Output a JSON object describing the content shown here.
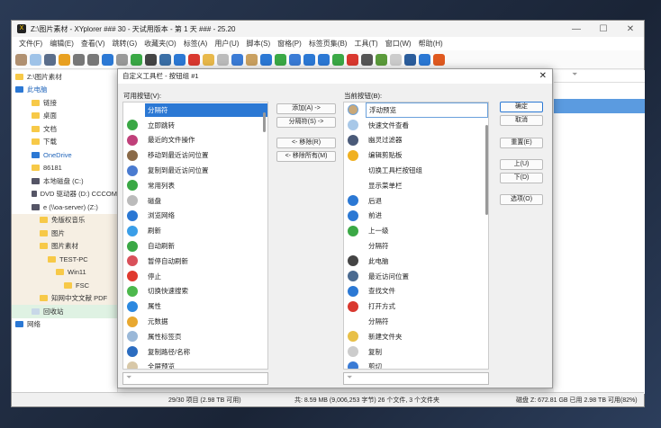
{
  "window": {
    "title": "Z:\\图片素材 - XYplorer ### 30 - 天试用版本 - 第 1 天 ### - 25.20",
    "controls": [
      "—",
      "☐",
      "✕"
    ]
  },
  "menu": [
    "文件(F)",
    "编辑(E)",
    "查看(V)",
    "跳转(G)",
    "收藏夹(O)",
    "标签(A)",
    "用户(U)",
    "脚本(S)",
    "窗格(P)",
    "标签页集(B)",
    "工具(T)",
    "窗口(W)",
    "帮助(H)"
  ],
  "toolbar_colors": [
    "#b09070",
    "#9fc3e8",
    "#5a6d8a",
    "#e8a020",
    "#777",
    "#777",
    "#2b78d4",
    "#999",
    "#3aa845",
    "#444",
    "#3a6ea5",
    "#2b78d4",
    "#d9382f",
    "#e8b84a",
    "#bbb",
    "#3a7bd5",
    "#c9a060",
    "#2b78d4",
    "#3aa845",
    "#3a7bd5",
    "#2b78d4",
    "#2b78d4",
    "#3aa845",
    "#d9382f",
    "#555",
    "#5a9a3a",
    "#ccc",
    "#2b5d9c",
    "#2b78d4",
    "#e05a20"
  ],
  "tree": [
    {
      "label": "Z:\\图片素材",
      "indent": 0,
      "type": "folder"
    },
    {
      "label": "此电脑",
      "indent": 0,
      "type": "pc",
      "blue": true
    },
    {
      "label": "链接",
      "indent": 2,
      "type": "folder"
    },
    {
      "label": "桌面",
      "indent": 2,
      "type": "folder"
    },
    {
      "label": "文档",
      "indent": 2,
      "type": "folder"
    },
    {
      "label": "下载",
      "indent": 2,
      "type": "folder"
    },
    {
      "label": "OneDrive",
      "indent": 2,
      "type": "cloud",
      "blue": true
    },
    {
      "label": "86181",
      "indent": 2,
      "type": "folder"
    },
    {
      "label": "本地磁盘 (C:)",
      "indent": 2,
      "type": "drive"
    },
    {
      "label": "DVD 驱动器 (D:) CCCOM",
      "indent": 2,
      "type": "drive"
    },
    {
      "label": "e (\\\\oa-server) (Z:)",
      "indent": 2,
      "type": "drive"
    },
    {
      "label": "免版权音乐",
      "indent": 3,
      "type": "folder",
      "sel": true
    },
    {
      "label": "图片",
      "indent": 3,
      "type": "folder",
      "sel": true
    },
    {
      "label": "图片素材",
      "indent": 3,
      "type": "folder",
      "sel": true
    },
    {
      "label": "TEST-PC",
      "indent": 4,
      "type": "folder",
      "sel": true
    },
    {
      "label": "Win11",
      "indent": 5,
      "type": "folder",
      "sel": true
    },
    {
      "label": "FSC",
      "indent": 6,
      "type": "folder",
      "sel": true
    },
    {
      "label": "知网中文文献 PDF",
      "indent": 3,
      "type": "folder",
      "sel": true
    },
    {
      "label": "回收站",
      "indent": 2,
      "type": "bin",
      "green": true
    },
    {
      "label": "网络",
      "indent": 0,
      "type": "net"
    }
  ],
  "dialog": {
    "title": "自定义工具栏 - 按钮组 #1",
    "close": "✕",
    "available_label": "可用按钮(V):",
    "current_label": "当前按钮(B):",
    "available": [
      {
        "label": "分隔符",
        "color": "",
        "selected": true
      },
      {
        "label": "立即跳转",
        "color": "#3aa845"
      },
      {
        "label": "最近的文件操作",
        "color": "#c0407a"
      },
      {
        "label": "移动到最近访问位置",
        "color": "#8a6a48"
      },
      {
        "label": "复制到最近访问位置",
        "color": "#4a7bd0"
      },
      {
        "label": "常用列表",
        "color": "#3aa845"
      },
      {
        "label": "磁盘",
        "color": "#bbbbbb"
      },
      {
        "label": "浏览网络",
        "color": "#2b78d4"
      },
      {
        "label": "刷新",
        "color": "#3a9ee8"
      },
      {
        "label": "自动刷新",
        "color": "#3aa845"
      },
      {
        "label": "暂停自动刷新",
        "color": "#d9505a"
      },
      {
        "label": "停止",
        "color": "#e03a2f"
      },
      {
        "label": "切换快速搜索",
        "color": "#4cb84c"
      },
      {
        "label": "属性",
        "color": "#2b88e0"
      },
      {
        "label": "元数据",
        "color": "#e8a830"
      },
      {
        "label": "属性标签页",
        "color": "#9ab8d8"
      },
      {
        "label": "复制路径/名称",
        "color": "#2b6cc0"
      },
      {
        "label": "全屏预览",
        "color": "#d8c8a8"
      }
    ],
    "current": [
      {
        "label": "浮动预览",
        "color": "#c9a878",
        "selected": true
      },
      {
        "label": "快速文件查看",
        "color": "#a8c8e8"
      },
      {
        "label": "幽灵过滤器",
        "color": "#4a5a78"
      },
      {
        "label": "编辑剪贴板",
        "color": "#f0b020"
      },
      {
        "label": "切换工具栏按钮组",
        "color": ""
      },
      {
        "label": "显示菜单栏",
        "color": ""
      },
      {
        "label": "后退",
        "color": "#2b78d4"
      },
      {
        "label": "前进",
        "color": "#2b78d4"
      },
      {
        "label": "上一级",
        "color": "#3aa845"
      },
      {
        "label": "分隔符",
        "color": ""
      },
      {
        "label": "此电脑",
        "color": "#444444"
      },
      {
        "label": "最近访问位置",
        "color": "#4a6a90"
      },
      {
        "label": "查找文件",
        "color": "#2b78d4"
      },
      {
        "label": "打开方式",
        "color": "#d9382f"
      },
      {
        "label": "分隔符",
        "color": ""
      },
      {
        "label": "新建文件夹",
        "color": "#e8c048"
      },
      {
        "label": "复制",
        "color": "#cccccc"
      },
      {
        "label": "剪切",
        "color": "#3a7bd5"
      }
    ],
    "mid_buttons": {
      "add": "添加(A) ->",
      "separator": "分隔符(S) ->",
      "remove": "<- 移除(R)",
      "remove_all": "<- 移除所有(M)"
    },
    "right_buttons": {
      "ok": "确定",
      "cancel": "取消",
      "reset": "重置(E)",
      "up": "上(U)",
      "down": "下(D)",
      "options": "选项(O)"
    },
    "filter_icon": "⏷"
  },
  "status": {
    "items": "29/30 项目 (2.98 TB 可用)",
    "total": "共: 8.59 MB (9,006,253 字节)  26 个文件, 3 个文件夹",
    "disk": "磁盘 Z: 672.81 GB 已用  2.98 TB 可用(82%)"
  }
}
